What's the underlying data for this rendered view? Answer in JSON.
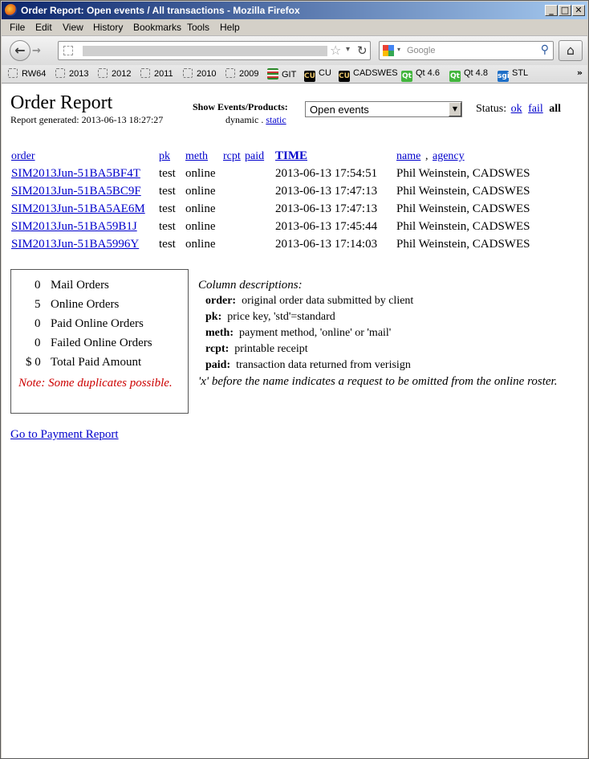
{
  "window": {
    "title": "Order Report: Open events / All transactions - Mozilla Firefox"
  },
  "menu": [
    "File",
    "Edit",
    "View",
    "History",
    "Bookmarks",
    "Tools",
    "Help"
  ],
  "search": {
    "placeholder": "Google"
  },
  "bookmarks": [
    "RW64",
    "2013",
    "2012",
    "2011",
    "2010",
    "2009",
    "GIT",
    "CU",
    "CADSWES",
    "Qt 4.6",
    "Qt 4.8",
    "STL"
  ],
  "page": {
    "title": "Order Report",
    "generated": "Report generated: 2013-06-13 18:27:27",
    "show_label": "Show Events/Products:",
    "dynamic": "dynamic",
    "dot": ".",
    "static": "static",
    "selected_option": "Open events",
    "status_label": "Status:",
    "status_ok": "ok",
    "status_fail": "fail",
    "status_all": "all"
  },
  "table": {
    "headers": {
      "order": "order",
      "pk": "pk",
      "meth": "meth",
      "rcpt": "rcpt",
      "paid": "paid",
      "time": "TIME",
      "name": "name",
      "comma": ",",
      "agency": "agency"
    },
    "rows": [
      {
        "order": "SIM2013Jun-51BA5BF4T",
        "pk": "test",
        "meth": "online",
        "time": "2013-06-13 17:54:51",
        "name": "Phil Weinstein, CADSWES"
      },
      {
        "order": "SIM2013Jun-51BA5BC9F",
        "pk": "test",
        "meth": "online",
        "time": "2013-06-13 17:47:13",
        "name": "Phil Weinstein, CADSWES"
      },
      {
        "order": "SIM2013Jun-51BA5AE6M",
        "pk": "test",
        "meth": "online",
        "time": "2013-06-13 17:47:13",
        "name": "Phil Weinstein, CADSWES"
      },
      {
        "order": "SIM2013Jun-51BA59B1J",
        "pk": "test",
        "meth": "online",
        "time": "2013-06-13 17:45:44",
        "name": "Phil Weinstein, CADSWES"
      },
      {
        "order": "SIM2013Jun-51BA5996Y",
        "pk": "test",
        "meth": "online",
        "time": "2013-06-13 17:14:03",
        "name": "Phil Weinstein, CADSWES"
      }
    ]
  },
  "summary": {
    "rows": [
      {
        "count": "0",
        "label": "Mail Orders"
      },
      {
        "count": "5",
        "label": "Online Orders"
      },
      {
        "count": "0",
        "label": "Paid Online Orders"
      },
      {
        "count": "0",
        "label": "Failed Online Orders"
      },
      {
        "count": "$ 0",
        "label": "Total Paid Amount"
      }
    ],
    "note": "Note: Some duplicates possible."
  },
  "descriptions": {
    "title": "Column descriptions:",
    "items": [
      {
        "key": "order:",
        "text": "original order data submitted by client"
      },
      {
        "key": "pk:",
        "text": "price key, 'std'=standard"
      },
      {
        "key": "meth:",
        "text": "payment method, 'online' or 'mail'"
      },
      {
        "key": "rcpt:",
        "text": "printable receipt"
      },
      {
        "key": "paid:",
        "text": "transaction data returned from verisign"
      }
    ],
    "footer": "'x' before the name indicates a request to be omitted from the online roster."
  },
  "links": {
    "payment_report": "Go to Payment Report"
  },
  "colors": {
    "link": "#0000cc",
    "note": "#cc0000",
    "titlebar": "#0a246a"
  }
}
